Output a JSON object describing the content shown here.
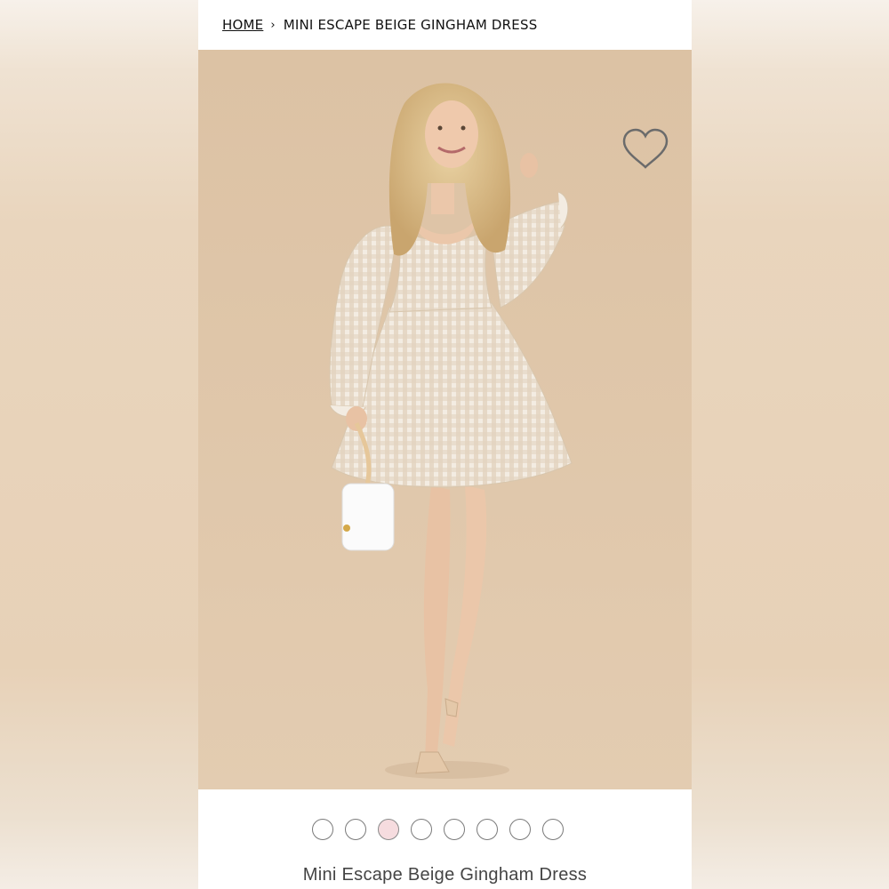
{
  "breadcrumb": {
    "home": "HOME",
    "separator": "›",
    "current": "MINI ESCAPE BEIGE GINGHAM DRESS"
  },
  "product": {
    "title": "Mini Escape Beige Gingham Dress",
    "image_alt": "Model wearing beige gingham mini dress",
    "favorite_icon": "heart-outline-icon"
  },
  "carousel": {
    "count": 8,
    "active_index": 2,
    "active_color": "#f6dcdf"
  },
  "colors": {
    "background": "#ead8c3",
    "hero_bg": "#dfc6a9",
    "text": "#111111"
  }
}
